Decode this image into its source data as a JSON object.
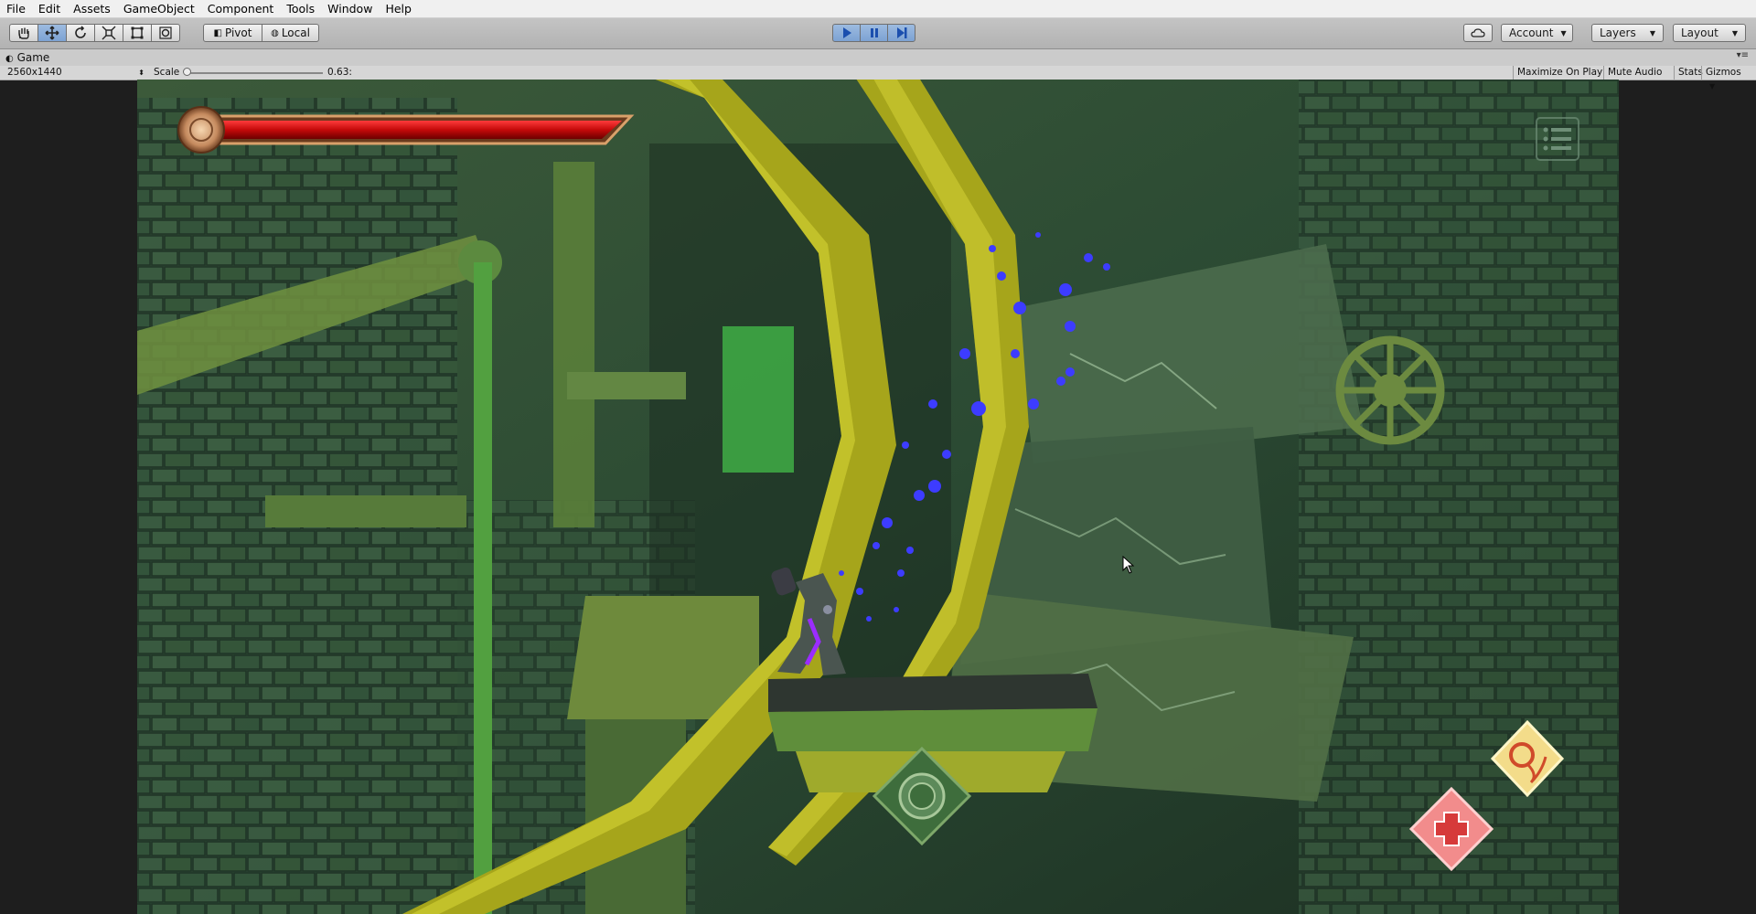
{
  "menu": [
    "File",
    "Edit",
    "Assets",
    "GameObject",
    "Component",
    "Tools",
    "Window",
    "Help"
  ],
  "toolbar": {
    "transform_tools": [
      "hand-tool-icon",
      "move-tool-icon",
      "rotate-tool-icon",
      "scale-tool-icon",
      "rect-tool-icon",
      "transform-tool-icon"
    ],
    "pivot_label": "Pivot",
    "local_label": "Local",
    "playback": [
      "play-icon",
      "pause-icon",
      "step-icon"
    ],
    "account_label": "Account",
    "layers_label": "Layers",
    "layout_label": "Layout"
  },
  "tab": {
    "title": "Game"
  },
  "game_toolbar": {
    "resolution": "2560x1440",
    "scale_label": "Scale",
    "scale_value": "0.63:",
    "maximize_on_play": "Maximize On Play",
    "mute_audio": "Mute Audio",
    "stats": "Stats",
    "gizmos": "Gizmos"
  },
  "hud": {
    "health_percent": 100,
    "health_color": "#c40a0a",
    "skill_icons": [
      "fire-skill-icon",
      "heal-skill-icon"
    ],
    "skill_colors": [
      "#f3dc8a",
      "#f28c8c"
    ]
  },
  "colors": {
    "toolbar_bg": "#b8b8b8",
    "play_active": "#7ca2d3",
    "scene_dark": "#1f3324",
    "scene_yellow": "#a6a51b"
  }
}
